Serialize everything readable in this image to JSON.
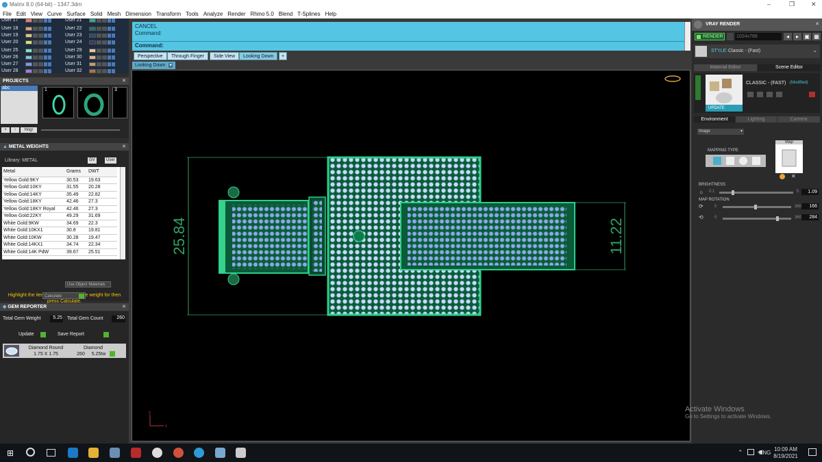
{
  "app": {
    "title": "Matrix 8.0 (64-bit) - 1347.3dm"
  },
  "menu": [
    "File",
    "Edit",
    "View",
    "Curve",
    "Surface",
    "Solid",
    "Mesh",
    "Dimension",
    "Transform",
    "Tools",
    "Analyze",
    "Render",
    "Rhino 5.0",
    "Blend",
    "T-Splines",
    "Help"
  ],
  "layers": {
    "col1": [
      "User 17",
      "User 18",
      "User 19",
      "User 20",
      "User 25",
      "User 26",
      "User 27",
      "User 28"
    ],
    "col2": [
      "User 21",
      "User 22",
      "User 23",
      "User 24",
      "User 29",
      "User 30",
      "User 31",
      "User 32"
    ],
    "col1_colors": [
      "#e27c7c",
      "#e2a17c",
      "#e2c77c",
      "#d6df7a",
      "#7ce2c9",
      "#7cc5e2",
      "#7c9ae2",
      "#a27ce2"
    ],
    "col2_colors": [
      "#3aa88a",
      "#2e6e6e",
      "#2e4a6e",
      "#3a3a6e",
      "#e0c8a0",
      "#e0b090",
      "#c0a070",
      "#b07050"
    ]
  },
  "projects": {
    "title": "PROJECTS",
    "item": "abc",
    "thumb_numbers": [
      "1",
      "2",
      "3"
    ],
    "btn_hinge": "Hngr"
  },
  "metal_weights": {
    "title": "METAL WEIGHTS",
    "library_label": "Library: METAL",
    "gv": "GV",
    "user": "User",
    "headers": [
      "Metal",
      "Grams",
      "DWT"
    ],
    "rows": [
      [
        "Yellow Gold:9KY",
        "30.53",
        "19.63"
      ],
      [
        "Yellow Gold:10KY",
        "31.55",
        "20.28"
      ],
      [
        "Yellow Gold:14KY",
        "35.49",
        "22.82"
      ],
      [
        "Yellow Gold:18KY",
        "42.46",
        "27.3"
      ],
      [
        "Yellow Gold:18KY Royal",
        "42.46",
        "27.3"
      ],
      [
        "Yellow Gold:22KY",
        "49.29",
        "31.69"
      ],
      [
        "White Gold:9KW",
        "34.69",
        "22.3"
      ],
      [
        "White Gold:10KX1",
        "30.8",
        "19.81"
      ],
      [
        "White Gold:10KW",
        "30.28",
        "19.47"
      ],
      [
        "White Gold:14KX1",
        "34.74",
        "22.34"
      ],
      [
        "White Gold:14K PdW",
        "39.67",
        "25.51"
      ]
    ],
    "use_object": "Use Object Materials",
    "hint": "Highlight the item you want to find the weight for then press Calculate.",
    "calculate": "Calculate"
  },
  "gem_reporter": {
    "title": "GEM REPORTER",
    "total_weight_label": "Total Gem Weight",
    "total_weight": "5.25",
    "total_count_label": "Total Gem Count",
    "total_count": "260",
    "update": "Update",
    "save_report": "Save Report",
    "gem_name": "Diamond Round",
    "gem_size": "1.75 X 1.75",
    "gem_material": "Diamond",
    "gem_count": "260",
    "gem_ctw": "5.25tw"
  },
  "command": {
    "line1": "CANCEL",
    "line2": "Command:",
    "prompt": "Command:"
  },
  "viewports": {
    "tabs": [
      "Perspective",
      "Through Finger",
      "Side View",
      "Looking Down"
    ],
    "active": "Looking Down",
    "add": "+",
    "current": "Looking Down",
    "dim_left": "25.84",
    "dim_right": "11.22",
    "axis_y": "y",
    "axis_x": "x"
  },
  "vray": {
    "title": "VRAY RENDER",
    "render_btn": "RENDER",
    "resolution": "1024x768",
    "style_label": "STYLE:",
    "style_value": "Classic - (Fast)",
    "tab_material": "Material Editor",
    "tab_scene": "Scene Editor",
    "preset_name": "CLASSIC - (FAST)",
    "preset_state": "(Modified)",
    "update": "UPDATE",
    "sub_tabs": [
      "Environment",
      "Lighting",
      "Camera"
    ],
    "env_type": "Image",
    "mapping_type": "MAPPING TYPE",
    "map_label": "Map",
    "brightness_label": "BRIGHTNESS",
    "brightness_min": "0.1",
    "brightness_max": "5",
    "brightness_value": "1.09",
    "rotation_label": "MAP ROTATION",
    "rot1_min": "0",
    "rot1_max": "360",
    "rot1_value": "166",
    "rot2_min": "0",
    "rot2_max": "360",
    "rot2_value": "284"
  },
  "watermark": {
    "line1": "Activate Windows",
    "line2": "Go to Settings to activate Windows."
  },
  "taskbar": {
    "lang": "ENG",
    "time": "10:09 AM",
    "date": "8/19/2021"
  }
}
